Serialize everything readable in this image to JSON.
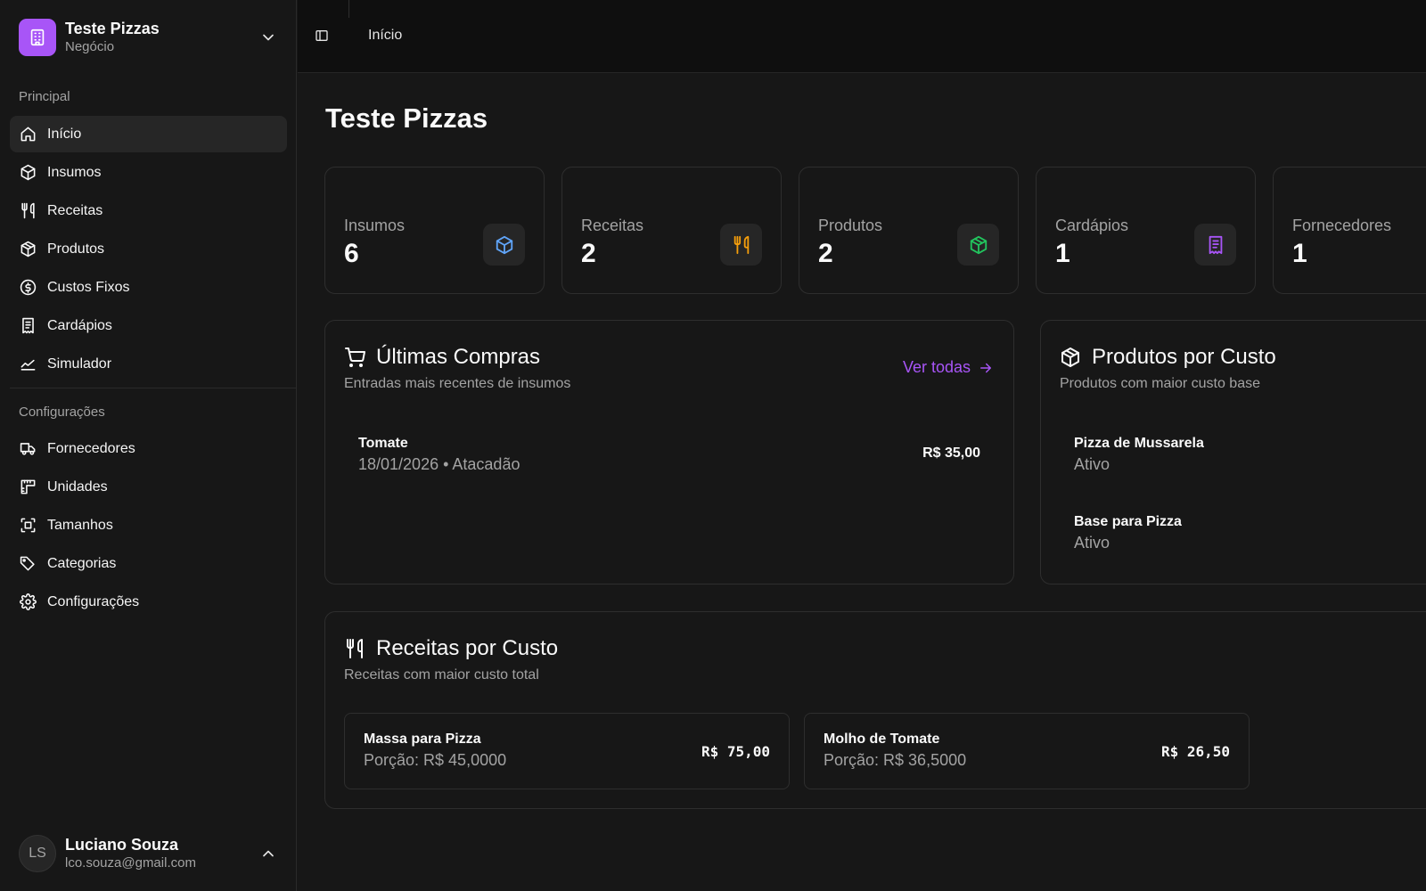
{
  "brand": {
    "name": "Teste Pizzas",
    "subtitle": "Negócio"
  },
  "sidebar": {
    "group_main": "Principal",
    "group_config": "Configurações",
    "items": [
      {
        "label": "Início",
        "icon": "home-icon"
      },
      {
        "label": "Insumos",
        "icon": "box-icon"
      },
      {
        "label": "Receitas",
        "icon": "utensils-icon"
      },
      {
        "label": "Produtos",
        "icon": "package-icon"
      },
      {
        "label": "Custos Fixos",
        "icon": "dollar-circle-icon"
      },
      {
        "label": "Cardápios",
        "icon": "receipt-icon"
      },
      {
        "label": "Simulador",
        "icon": "chart-line-icon"
      },
      {
        "label": "Fornecedores",
        "icon": "truck-icon"
      },
      {
        "label": "Unidades",
        "icon": "ruler-icon"
      },
      {
        "label": "Tamanhos",
        "icon": "scan-icon"
      },
      {
        "label": "Categorias",
        "icon": "tags-icon"
      },
      {
        "label": "Configurações",
        "icon": "gear-icon"
      }
    ]
  },
  "user": {
    "initials": "LS",
    "name": "Luciano Souza",
    "email": "lco.souza@gmail.com"
  },
  "header": {
    "breadcrumb": "Início"
  },
  "page": {
    "title": "Teste Pizzas"
  },
  "stats": [
    {
      "label": "Insumos",
      "value": "6",
      "color": "#60a5fa"
    },
    {
      "label": "Receitas",
      "value": "2",
      "color": "#f59e0b"
    },
    {
      "label": "Produtos",
      "value": "2",
      "color": "#22c55e"
    },
    {
      "label": "Cardápios",
      "value": "1",
      "color": "#a855f7"
    },
    {
      "label": "Fornecedores",
      "value": "1",
      "color": "#f97316"
    }
  ],
  "purchases": {
    "title": "Últimas Compras",
    "subtitle": "Entradas mais recentes de insumos",
    "see_all": "Ver todas",
    "rows": [
      {
        "name": "Tomate",
        "detail": "18/01/2026 • Atacadão",
        "amount": "R$ 35,00"
      }
    ]
  },
  "products": {
    "title": "Produtos por Custo",
    "subtitle": "Produtos com maior custo base",
    "rows": [
      {
        "name": "Pizza de Mussarela",
        "status": "Ativo"
      },
      {
        "name": "Base para Pizza",
        "status": "Ativo"
      }
    ]
  },
  "recipes": {
    "title": "Receitas por Custo",
    "subtitle": "Receitas com maior custo total",
    "cards": [
      {
        "name": "Massa para Pizza",
        "portion": "Porção: R$ 45,0000",
        "amount": "R$ 75,00"
      },
      {
        "name": "Molho de Tomate",
        "portion": "Porção: R$ 36,5000",
        "amount": "R$ 26,50"
      }
    ]
  },
  "colors": {
    "accent": "#a855f7",
    "background": "#171717",
    "header": "#0f0f0f"
  }
}
